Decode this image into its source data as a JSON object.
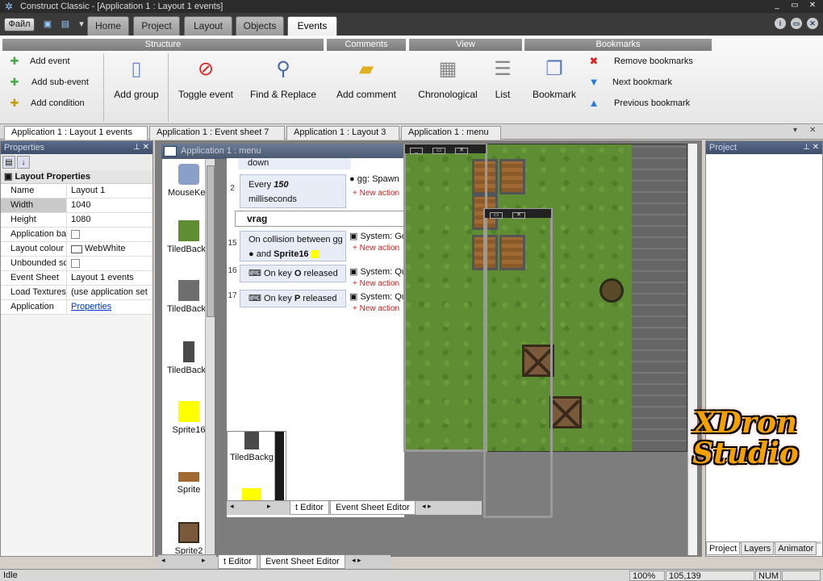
{
  "window": {
    "title": "Construct Classic - [Application 1 : Layout 1 events]",
    "controls": [
      "_",
      "▭",
      "✕"
    ]
  },
  "ribbon": {
    "file_label": "Файл",
    "tabs": [
      "Home",
      "Project",
      "Layout",
      "Objects",
      "Events"
    ],
    "active_tab": "Events",
    "groups": {
      "structure": "Structure",
      "comments": "Comments",
      "view": "View",
      "bookmarks": "Bookmarks"
    },
    "buttons": {
      "add_event": "Add event",
      "add_sub_event": "Add sub-event",
      "add_condition": "Add condition",
      "add_group": "Add group",
      "toggle_event": "Toggle event",
      "find_replace": "Find & Replace",
      "add_comment": "Add comment",
      "chronological": "Chronological",
      "list": "List",
      "bookmark": "Bookmark",
      "remove_bookmarks": "Remove bookmarks",
      "next_bookmark": "Next bookmark",
      "previous_bookmark": "Previous bookmark"
    }
  },
  "doc_tabs": [
    "Application 1 : Layout 1 events",
    "Application 1 : Event sheet 7",
    "Application 1 : Layout 3",
    "Application 1 : menu"
  ],
  "properties": {
    "panel_title": "Properties",
    "section": "Layout Properties",
    "rows": [
      {
        "name": "Name",
        "value": "Layout 1"
      },
      {
        "name": "Width",
        "value": "1040"
      },
      {
        "name": "Height",
        "value": "1080"
      },
      {
        "name": "Application back",
        "value": ""
      },
      {
        "name": "Layout colour",
        "value": "WebWhite"
      },
      {
        "name": "Unbounded scro",
        "value": ""
      },
      {
        "name": "Event Sheet",
        "value": "Layout 1 events"
      },
      {
        "name": "Load Textures",
        "value": "(use application set"
      },
      {
        "name": "Application",
        "value": "Properties"
      }
    ]
  },
  "objects": [
    {
      "label": "MouseKey",
      "color": "#8aa0c8"
    },
    {
      "label": "TiledBackg",
      "color": "#5f8d34"
    },
    {
      "label": "TiledBackg",
      "color": "#6e6e6e"
    },
    {
      "label": "TiledBackg",
      "color": "#4a4a4a"
    },
    {
      "label": "Sprite16",
      "color": "#ffff00"
    },
    {
      "label": "Sprite",
      "color": "#a06a32"
    },
    {
      "label": "Sprite2",
      "color": "#7a5a3a"
    }
  ],
  "float_objects": [
    {
      "label": "TiledBackg",
      "color": "#4a4a4a"
    },
    {
      "label": "",
      "color": "#ffff00"
    }
  ],
  "event_window": {
    "title": "Application 1 : menu"
  },
  "events": {
    "partial_top": "down",
    "e2": {
      "num": "2",
      "cond_prefix": "Every",
      "cond_value": "150",
      "cond_suffix": "milliseconds",
      "action": "gg: Spawn",
      "new_action": "+ New action"
    },
    "group": "vrag",
    "e15": {
      "num": "15",
      "cond_line1": "On collision between gg",
      "cond_and": "and",
      "cond_obj": "Sprite16",
      "action": "System: Go",
      "new_action": "+ New action"
    },
    "e16": {
      "num": "16",
      "cond_prefix": "On key",
      "cond_key": "O",
      "cond_suffix": "released",
      "action": "System: Qu",
      "new_action": "+ New action"
    },
    "e17": {
      "num": "17",
      "cond_prefix": "On key",
      "cond_key": "P",
      "cond_suffix": "released",
      "action": "System: Qu",
      "new_action": "+ New action"
    }
  },
  "sheet_tabs": {
    "inner": [
      "t Editor",
      "Event Sheet Editor"
    ],
    "outer": [
      "t Editor",
      "Event Sheet Editor"
    ]
  },
  "project": {
    "panel_title": "Project",
    "tabs": [
      "Project",
      "Layers",
      "Animator"
    ]
  },
  "watermark": {
    "line1": "XDron",
    "line2": "Studio"
  },
  "status": {
    "state": "Idle",
    "zoom": "100%",
    "coords": "105,139",
    "num": "NUM"
  },
  "colors": {
    "accent": "#4a5870",
    "new_action": "#cc2222",
    "sprite16": "#ffff00",
    "watermark": "#f4a000"
  }
}
